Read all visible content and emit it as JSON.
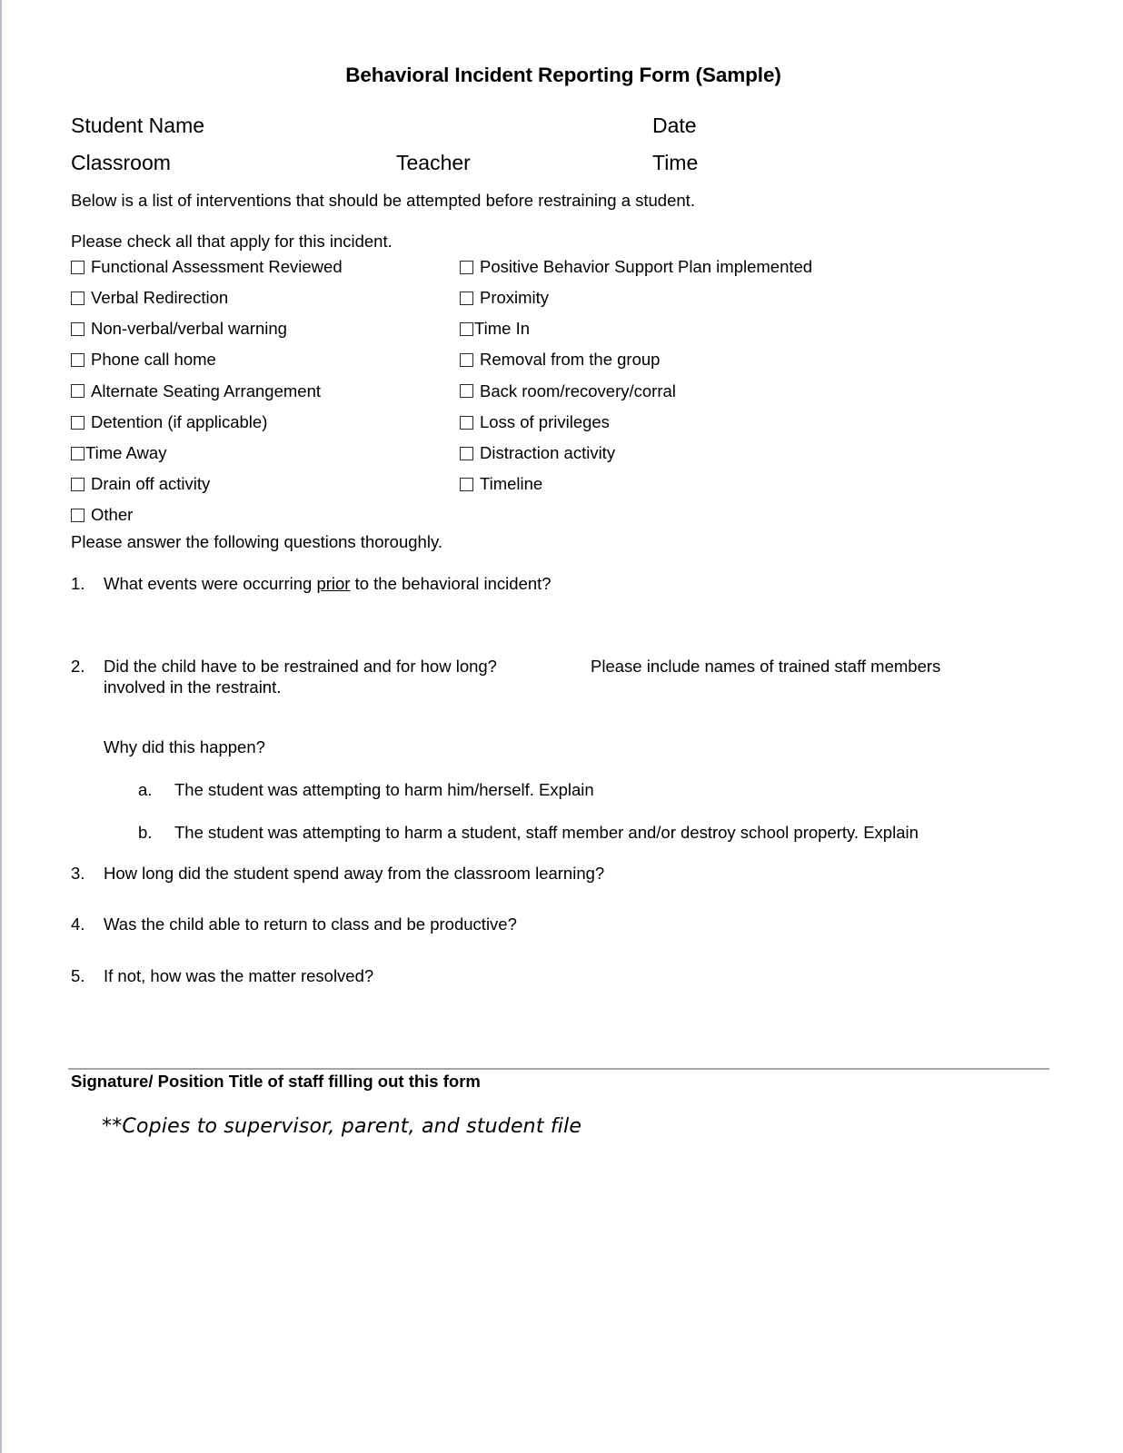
{
  "document": {
    "title": "Behavioral Incident Reporting Form (Sample)"
  },
  "header_fields": {
    "row1": {
      "name_label": "Student Name",
      "mid_label": "",
      "right_label": "Date"
    },
    "row2": {
      "name_label": "Classroom",
      "mid_label": "Teacher",
      "right_label": "Time"
    }
  },
  "intro": {
    "interventions_note": "Below is a list of interventions that should be attempted before restraining a student.",
    "check_all_instruction": "Please check all that apply for this incident.",
    "questions_instruction": "Please answer the following questions thoroughly."
  },
  "checklist": {
    "left_column": [
      {
        "label": "Functional Assessment Reviewed",
        "checked": false,
        "tight": false
      },
      {
        "label": "Verbal Redirection",
        "checked": false,
        "tight": false
      },
      {
        "label": "Non-verbal/verbal warning",
        "checked": false,
        "tight": false
      },
      {
        "label": "Phone call home",
        "checked": false,
        "tight": false
      },
      {
        "label": "Alternate Seating Arrangement",
        "checked": false,
        "tight": false
      },
      {
        "label": "Detention (if applicable)",
        "checked": false,
        "tight": false
      },
      {
        "label": "Time Away",
        "checked": false,
        "tight": true
      },
      {
        "label": "Drain off activity",
        "checked": false,
        "tight": false
      },
      {
        "label": "Other",
        "checked": false,
        "tight": false
      }
    ],
    "right_column": [
      {
        "label": "Positive Behavior Support Plan implemented",
        "checked": false,
        "tight": false
      },
      {
        "label": "Proximity",
        "checked": false,
        "tight": false
      },
      {
        "label": "Time In",
        "checked": false,
        "tight": true
      },
      {
        "label": "Removal from the group",
        "checked": false,
        "tight": false
      },
      {
        "label": "Back room/recovery/corral",
        "checked": false,
        "tight": false
      },
      {
        "label": "Loss of privileges",
        "checked": false,
        "tight": false
      },
      {
        "label": "Distraction activity",
        "checked": false,
        "tight": false
      },
      {
        "label": "Timeline",
        "checked": false,
        "tight": false
      }
    ]
  },
  "questions": {
    "q1": {
      "number": "1.",
      "text_before": "What events were occurring ",
      "underlined": "prior",
      "text_after": " to the behavioral incident?"
    },
    "q2": {
      "number": "2.",
      "main": "Did the child have to be restrained and for how long?",
      "aside": "Please include names of trained staff members",
      "second_line": "involved in the restraint.",
      "why_heading": "Why did this happen?",
      "sub_items": [
        {
          "letter": "a.",
          "text": "The student was attempting to harm him/herself.  Explain"
        },
        {
          "letter": "b.",
          "text": "The student was attempting to harm a student, staff member and/or destroy school property.  Explain"
        }
      ]
    },
    "q3": {
      "number": "3.",
      "text": "How long did the student spend away from the classroom learning?"
    },
    "q4": {
      "number": "4.",
      "text": "Was the child able to return to class and be productive?"
    },
    "q5": {
      "number": "5.",
      "text": "If not, how was the matter resolved?"
    }
  },
  "footer": {
    "signature_label": "Signature/ Position Title of staff filling out this form",
    "copies_note": "**Copies to supervisor, parent, and student file",
    "rule_color": "#a6a6a6"
  }
}
